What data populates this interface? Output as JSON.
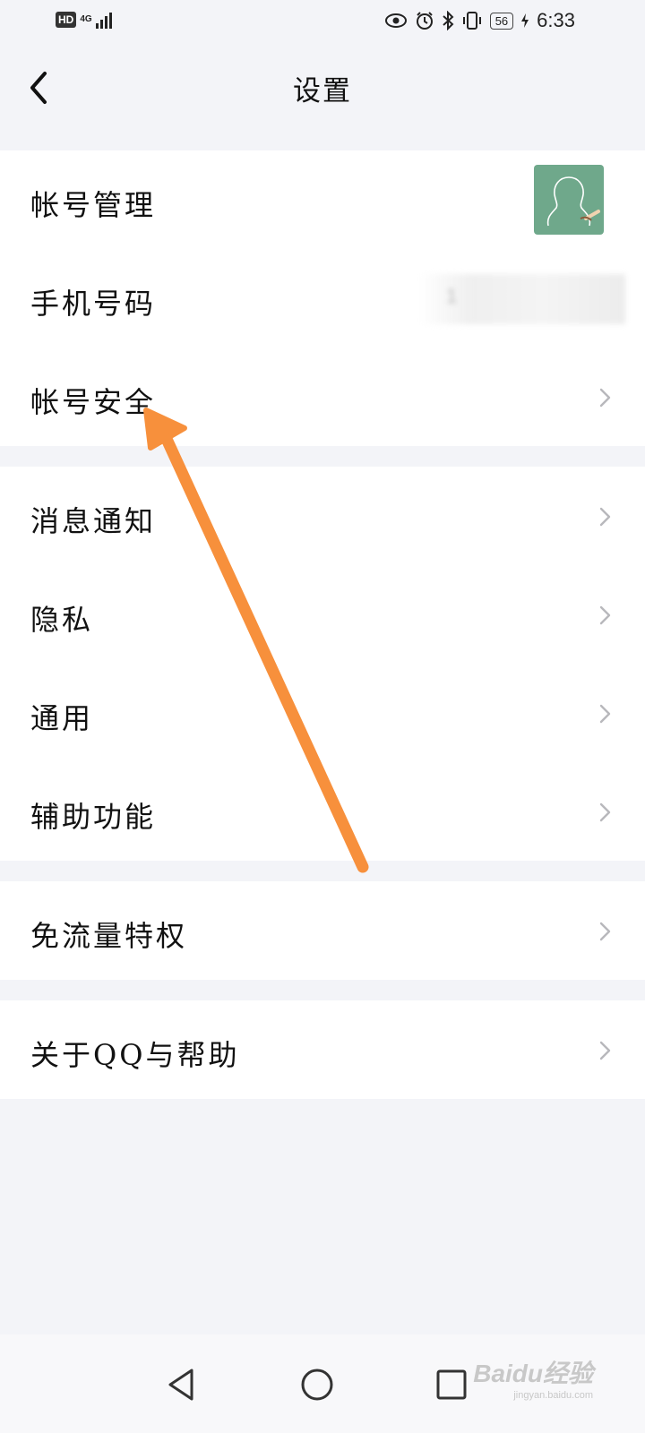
{
  "status_bar": {
    "hd_label": "HD",
    "network": "4G",
    "battery": "56",
    "time": "6:33"
  },
  "header": {
    "title": "设置"
  },
  "groups": [
    {
      "items": [
        {
          "label": "帐号管理",
          "trailing": "avatar"
        },
        {
          "label": "手机号码",
          "trailing": "phone",
          "value": "1"
        },
        {
          "label": "帐号安全",
          "trailing": "chevron"
        }
      ]
    },
    {
      "items": [
        {
          "label": "消息通知",
          "trailing": "chevron"
        },
        {
          "label": "隐私",
          "trailing": "chevron"
        },
        {
          "label": "通用",
          "trailing": "chevron"
        },
        {
          "label": "辅助功能",
          "trailing": "chevron"
        }
      ]
    },
    {
      "items": [
        {
          "label": "免流量特权",
          "trailing": "chevron"
        }
      ]
    },
    {
      "items": [
        {
          "label": "关于QQ与帮助",
          "trailing": "chevron"
        }
      ]
    }
  ],
  "watermark": {
    "brand": "Baidu经验",
    "url": "jingyan.baidu.com"
  },
  "colors": {
    "background": "#f3f4f8",
    "annotation_arrow": "#f7903c",
    "avatar_bg": "#6fa88b"
  }
}
